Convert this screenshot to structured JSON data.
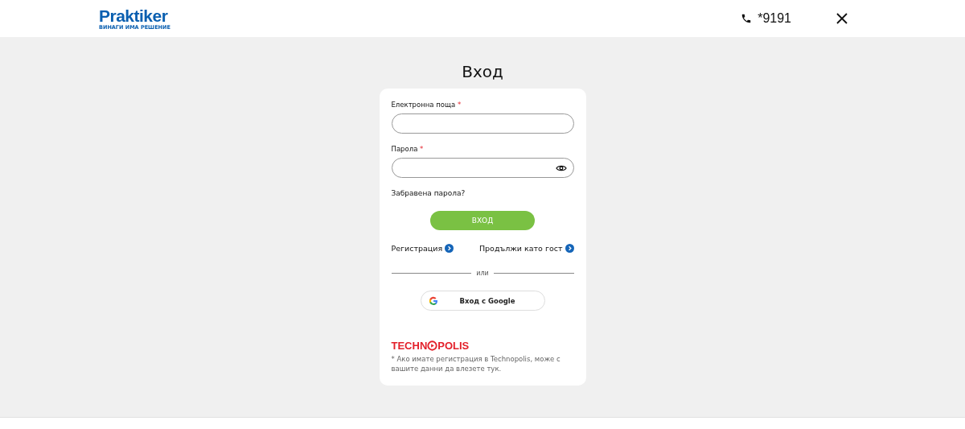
{
  "header": {
    "logo": {
      "name": "Praktiker",
      "tagline": "ВИНАГИ ИМА РЕШЕНИЕ"
    },
    "phone": "*9191"
  },
  "title": "Вход",
  "form": {
    "fields": [
      {
        "label": "Електронна поща",
        "required_mark": "*",
        "kind": "text"
      },
      {
        "label": "Парола",
        "required_mark": "*",
        "kind": "password"
      }
    ],
    "forgot_link": "Забравена парола?",
    "submit": "ВХОД",
    "links": [
      "Регистрация",
      "Продължи като гост"
    ],
    "divider": "или",
    "google_button": "Вход с Google",
    "partner": {
      "logo_before": "TECHN",
      "logo_after": "POLIS",
      "note": "* Ако имате регистрация в Technopolis, може с вашите данни да влезете тук."
    }
  }
}
